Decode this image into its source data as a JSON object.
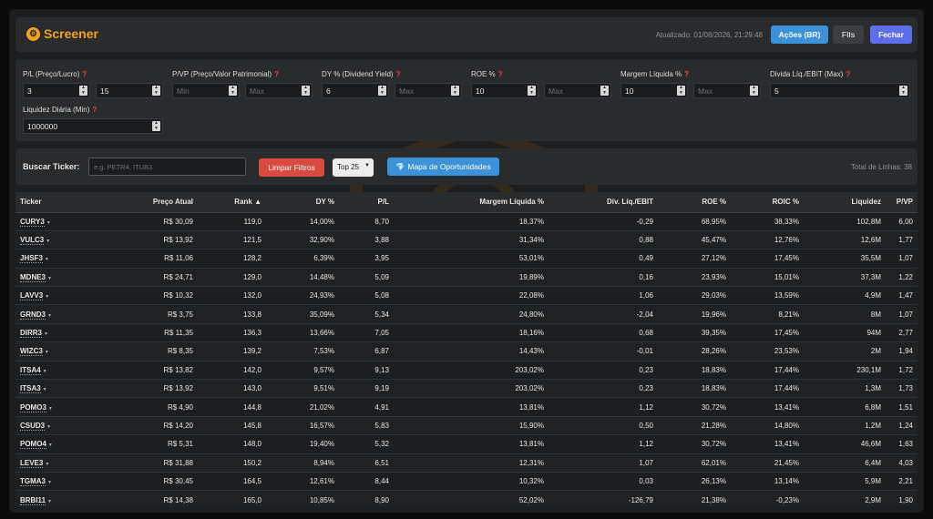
{
  "header": {
    "title": "Screener",
    "updated": "Atualizado: 01/08/2026, 21:29:48",
    "buttons": {
      "acoes": "Ações (BR)",
      "fiis": "FIIs",
      "fechar": "Fechar"
    }
  },
  "filters": [
    {
      "label": "P/L (Preço/Lucro)",
      "min": "3",
      "max": "15",
      "min_placeholder": "",
      "max_placeholder": ""
    },
    {
      "label": "P/VP (Preço/Valor Patrimonial)",
      "min": "",
      "max": "",
      "min_placeholder": "Min",
      "max_placeholder": "Max"
    },
    {
      "label": "DY % (Dividend Yield)",
      "min": "6",
      "max": "",
      "min_placeholder": "",
      "max_placeholder": "Max"
    },
    {
      "label": "ROE %",
      "min": "10",
      "max": "",
      "min_placeholder": "",
      "max_placeholder": "Max"
    },
    {
      "label": "Margem Líquida %",
      "min": "10",
      "max": "",
      "min_placeholder": "",
      "max_placeholder": "Max"
    },
    {
      "label": "Divida Líq./EBIT (Max)",
      "value": "5"
    },
    {
      "label": "Liquidez Diária (Min)",
      "value": "1000000"
    }
  ],
  "search": {
    "label": "Buscar Ticker:",
    "placeholder": "e.g. PETR4, ITUB3",
    "clear_label": "Limpar Filtros",
    "top_value": "Top 25",
    "map_label": "Mapa de Oportunidades",
    "total": "Total de Linhas: 38"
  },
  "table": {
    "columns": [
      "Ticker",
      "Preço Atual",
      "Rank ▲",
      "DY %",
      "P/L",
      "Margem Líquida %",
      "Dív. Líq./EBIT",
      "ROE %",
      "ROIC %",
      "Liquidez",
      "P/VP"
    ],
    "rows": [
      [
        "CURY3",
        "R$ 30,09",
        "119,0",
        "14,00%",
        "8,70",
        "18,37%",
        "-0,29",
        "68,95%",
        "38,33%",
        "102,8M",
        "6,00"
      ],
      [
        "VULC3",
        "R$ 13,92",
        "121,5",
        "32,90%",
        "3,88",
        "31,34%",
        "0,88",
        "45,47%",
        "12,76%",
        "12,6M",
        "1,77"
      ],
      [
        "JHSF3",
        "R$ 11,06",
        "128,2",
        "6,39%",
        "3,95",
        "53,01%",
        "0,49",
        "27,12%",
        "17,45%",
        "35,5M",
        "1,07"
      ],
      [
        "MDNE3",
        "R$ 24,71",
        "129,0",
        "14,48%",
        "5,09",
        "19,89%",
        "0,16",
        "23,93%",
        "15,01%",
        "37,3M",
        "1,22"
      ],
      [
        "LAVV3",
        "R$ 10,32",
        "132,0",
        "24,93%",
        "5,08",
        "22,08%",
        "1,06",
        "29,03%",
        "13,59%",
        "4,9M",
        "1,47"
      ],
      [
        "GRND3",
        "R$ 3,75",
        "133,8",
        "35,09%",
        "5,34",
        "24,80%",
        "-2,04",
        "19,96%",
        "8,21%",
        "8M",
        "1,07"
      ],
      [
        "DIRR3",
        "R$ 11,35",
        "136,3",
        "13,66%",
        "7,05",
        "18,16%",
        "0,68",
        "39,35%",
        "17,45%",
        "94M",
        "2,77"
      ],
      [
        "WIZC3",
        "R$ 8,35",
        "139,2",
        "7,53%",
        "6,87",
        "14,43%",
        "-0,01",
        "28,26%",
        "23,53%",
        "2M",
        "1,94"
      ],
      [
        "ITSA4",
        "R$ 13,82",
        "142,0",
        "9,57%",
        "9,13",
        "203,02%",
        "0,23",
        "18,83%",
        "17,44%",
        "230,1M",
        "1,72"
      ],
      [
        "ITSA3",
        "R$ 13,92",
        "143,0",
        "9,51%",
        "9,19",
        "203,02%",
        "0,23",
        "18,83%",
        "17,44%",
        "1,3M",
        "1,73"
      ],
      [
        "POMO3",
        "R$ 4,90",
        "144,8",
        "21,02%",
        "4,91",
        "13,81%",
        "1,12",
        "30,72%",
        "13,41%",
        "6,8M",
        "1,51"
      ],
      [
        "CSUD3",
        "R$ 14,20",
        "145,8",
        "16,57%",
        "5,83",
        "15,90%",
        "0,50",
        "21,28%",
        "14,80%",
        "1,2M",
        "1,24"
      ],
      [
        "POMO4",
        "R$ 5,31",
        "148,0",
        "19,40%",
        "5,32",
        "13,81%",
        "1,12",
        "30,72%",
        "13,41%",
        "46,6M",
        "1,63"
      ],
      [
        "LEVE3",
        "R$ 31,88",
        "150,2",
        "8,94%",
        "6,51",
        "12,31%",
        "1,07",
        "62,01%",
        "21,45%",
        "6,4M",
        "4,03"
      ],
      [
        "TGMA3",
        "R$ 30,45",
        "164,5",
        "12,61%",
        "8,44",
        "10,32%",
        "0,03",
        "26,13%",
        "13,14%",
        "5,9M",
        "2,21"
      ],
      [
        "BRBI11",
        "R$ 14,38",
        "165,0",
        "10,85%",
        "8,90",
        "52,02%",
        "-126,79",
        "21,38%",
        "-0,23%",
        "2,9M",
        "1,90"
      ]
    ]
  },
  "watermark": {
    "text": "Garimpo",
    "subtext": "Deep Market Prospecting"
  }
}
